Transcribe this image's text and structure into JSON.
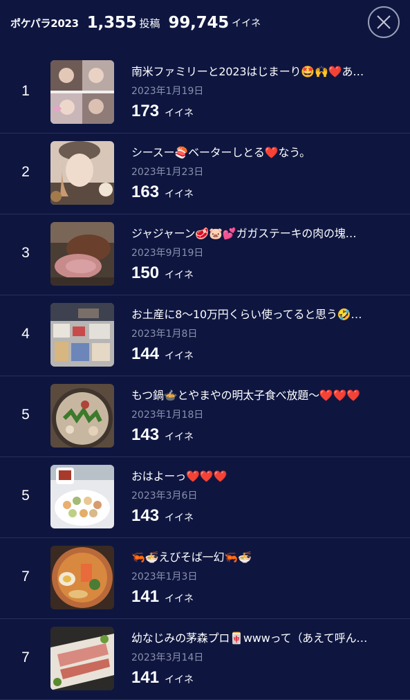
{
  "header": {
    "title": "ポケパラ2023",
    "posts_count": "1,355",
    "posts_label": "投稿",
    "likes_total": "99,745",
    "likes_label": "イイネ"
  },
  "colors": {
    "background": "#0e1640",
    "divider": "#27305c",
    "date_text": "#8b91ad",
    "text": "#ffffff"
  },
  "posts": [
    {
      "rank": "1",
      "title": "南米ファミリーと2023はじまーり🤩🙌❤️あ…",
      "date": "2023年1月19日",
      "likes": "173",
      "likes_label": "イイネ",
      "thumb_icon": "photo-people-icon"
    },
    {
      "rank": "2",
      "title": "シースー🍣ベーターしとる❤️なう。",
      "date": "2023年1月23日",
      "likes": "163",
      "likes_label": "イイネ",
      "thumb_icon": "photo-selfie-icon"
    },
    {
      "rank": "3",
      "title": "ジャジャーン🥩🐷💕ガガステーキの肉の塊…",
      "date": "2023年9月19日",
      "likes": "150",
      "likes_label": "イイネ",
      "thumb_icon": "photo-steak-icon"
    },
    {
      "rank": "4",
      "title": "お土産に8〜10万円くらい使ってると思う🤣…",
      "date": "2023年1月8日",
      "likes": "144",
      "likes_label": "イイネ",
      "thumb_icon": "photo-souvenirs-icon"
    },
    {
      "rank": "5",
      "title": "もつ鍋🍲とやまやの明太子食べ放題〜❤️❤️❤️",
      "date": "2023年1月18日",
      "likes": "143",
      "likes_label": "イイネ",
      "thumb_icon": "photo-hotpot-icon"
    },
    {
      "rank": "5",
      "title": "おはよーっ❤️❤️❤️",
      "date": "2023年3月6日",
      "likes": "143",
      "likes_label": "イイネ",
      "thumb_icon": "photo-breakfast-icon"
    },
    {
      "rank": "7",
      "title": "🦐🍜えびそば一幻🦐🍜",
      "date": "2023年1月3日",
      "likes": "141",
      "likes_label": "イイネ",
      "thumb_icon": "photo-ramen-icon"
    },
    {
      "rank": "7",
      "title": "幼なじみの茅森プロ🀄wwwって（あえて呼ん…",
      "date": "2023年3月14日",
      "likes": "141",
      "likes_label": "イイネ",
      "thumb_icon": "photo-dish-icon"
    }
  ]
}
